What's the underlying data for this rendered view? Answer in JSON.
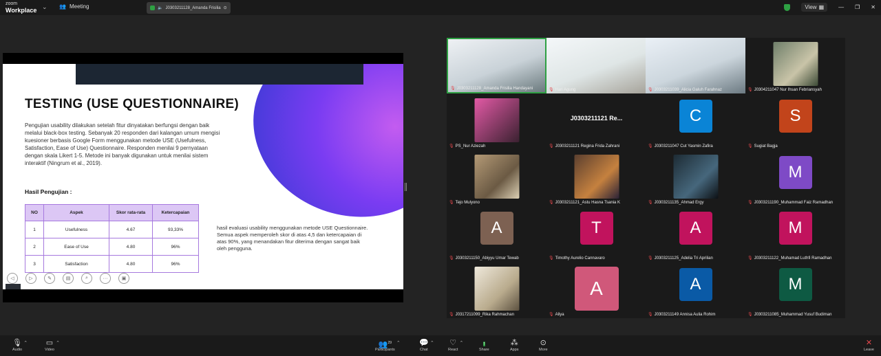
{
  "topbar": {
    "brand_line1": "zoom",
    "brand_line2": "Workplace",
    "meeting_label": "Meeting",
    "share_tab_label": "J0303211128_Amanda Frisilia",
    "view_label": "View"
  },
  "slide": {
    "title": "TESTING (USE QUESTIONNAIRE)",
    "paragraph": "Pengujian usability dilakukan setelah fitur dinyatakan berfungsi dengan baik melalui black-box testing. Sebanyak 20 responden dari kalangan umum mengisi kuesioner berbasis Google Form menggunakan metode USE (Usefulness, Satisfaction, Ease of Use) Questionnaire. Responden menilai 9 pernyataan dengan skala Likert 1-5. Metode ini banyak digunakan untuk menilai sistem interaktif (Ningrum et al., 2019).",
    "results_heading": "Hasil Pengujian :",
    "table": {
      "headers": [
        "NO",
        "Aspek",
        "Skor rata-rata",
        "Ketercapaian"
      ],
      "rows": [
        [
          "1",
          "Usefulness",
          "4.67",
          "93,33%"
        ],
        [
          "2",
          "Ease of Use",
          "4.80",
          "96%"
        ],
        [
          "3",
          "Satisfaction",
          "4.80",
          "96%"
        ]
      ]
    },
    "conclusion": "hasil evaluasi usability menggunakan metode USE Questionnaire. Semua aspek memperoleh skor di atas 4,5 dan ketercapaian di atas 90%, yang menandakan fitur diterima dengan sangat baik oleh pengguna."
  },
  "participants": [
    {
      "name": "J0303211128_Amanda Frisilia Handayani",
      "type": "video",
      "active": true
    },
    {
      "name": "Hari Agung",
      "type": "video"
    },
    {
      "name": "J0303211039_Alicia Galuh Farahnaz",
      "type": "video"
    },
    {
      "name": "J0304211047 Nur Ihsan Febriansyah",
      "type": "photo"
    },
    {
      "name": "PS_Nur Aziezah",
      "type": "photo"
    },
    {
      "name": "J0303211121 Regina Frida Zahrani",
      "type": "text",
      "display": "J0303211121 Re..."
    },
    {
      "name": "J0303211047 Cut Yasmin Zafira",
      "type": "letter",
      "letter": "C",
      "color": "#0a84d6"
    },
    {
      "name": "Sugiat Bagja",
      "type": "letter",
      "letter": "S",
      "color": "#c2441b"
    },
    {
      "name": "Tejo Mulyono",
      "type": "photo"
    },
    {
      "name": "J0303211121_Astu Hasna Tsania K",
      "type": "photo"
    },
    {
      "name": "J0303211135_Ahmad Ergy",
      "type": "photo"
    },
    {
      "name": "J0303211190_Muhammad Faiz Ramadhan",
      "type": "letter",
      "letter": "M",
      "color": "#7e4ac6"
    },
    {
      "name": "J0303211150_Abiyyu Umar Tewab",
      "type": "letter",
      "letter": "A",
      "color": "#7d6152"
    },
    {
      "name": "Timothy Aurelio Cannavaro",
      "type": "letter",
      "letter": "T",
      "color": "#c1135d"
    },
    {
      "name": "J0303211125_Adelia Tri Aprilian",
      "type": "letter",
      "letter": "A",
      "color": "#c1135d"
    },
    {
      "name": "J0303211122_Muhamad Luthfi Ramadhan",
      "type": "letter",
      "letter": "M",
      "color": "#c1135d"
    },
    {
      "name": "J0317211099_Rika Rahmachan",
      "type": "photo"
    },
    {
      "name": "Aliya",
      "type": "letter",
      "letter": "A",
      "color": "#d0587a",
      "big": true
    },
    {
      "name": "J0303211149 Annisa Aulia Rohim",
      "type": "letter",
      "letter": "A",
      "color": "#0a5aa6"
    },
    {
      "name": "J0303211085_Muhammad Yusuf Budiman",
      "type": "letter",
      "letter": "M",
      "color": "#0e5a43"
    }
  ],
  "toolbar": {
    "audio": "Audio",
    "video": "Video",
    "participants": "Participants",
    "participants_count": "29",
    "chat": "Chat",
    "react": "React",
    "share": "Share",
    "apps": "Apps",
    "more": "More",
    "leave": "Leave"
  },
  "colors": {
    "active_border": "#2ea043",
    "share_green": "#2ea043",
    "table_header": "#dcc7f5",
    "leave_red": "#e5484d"
  }
}
